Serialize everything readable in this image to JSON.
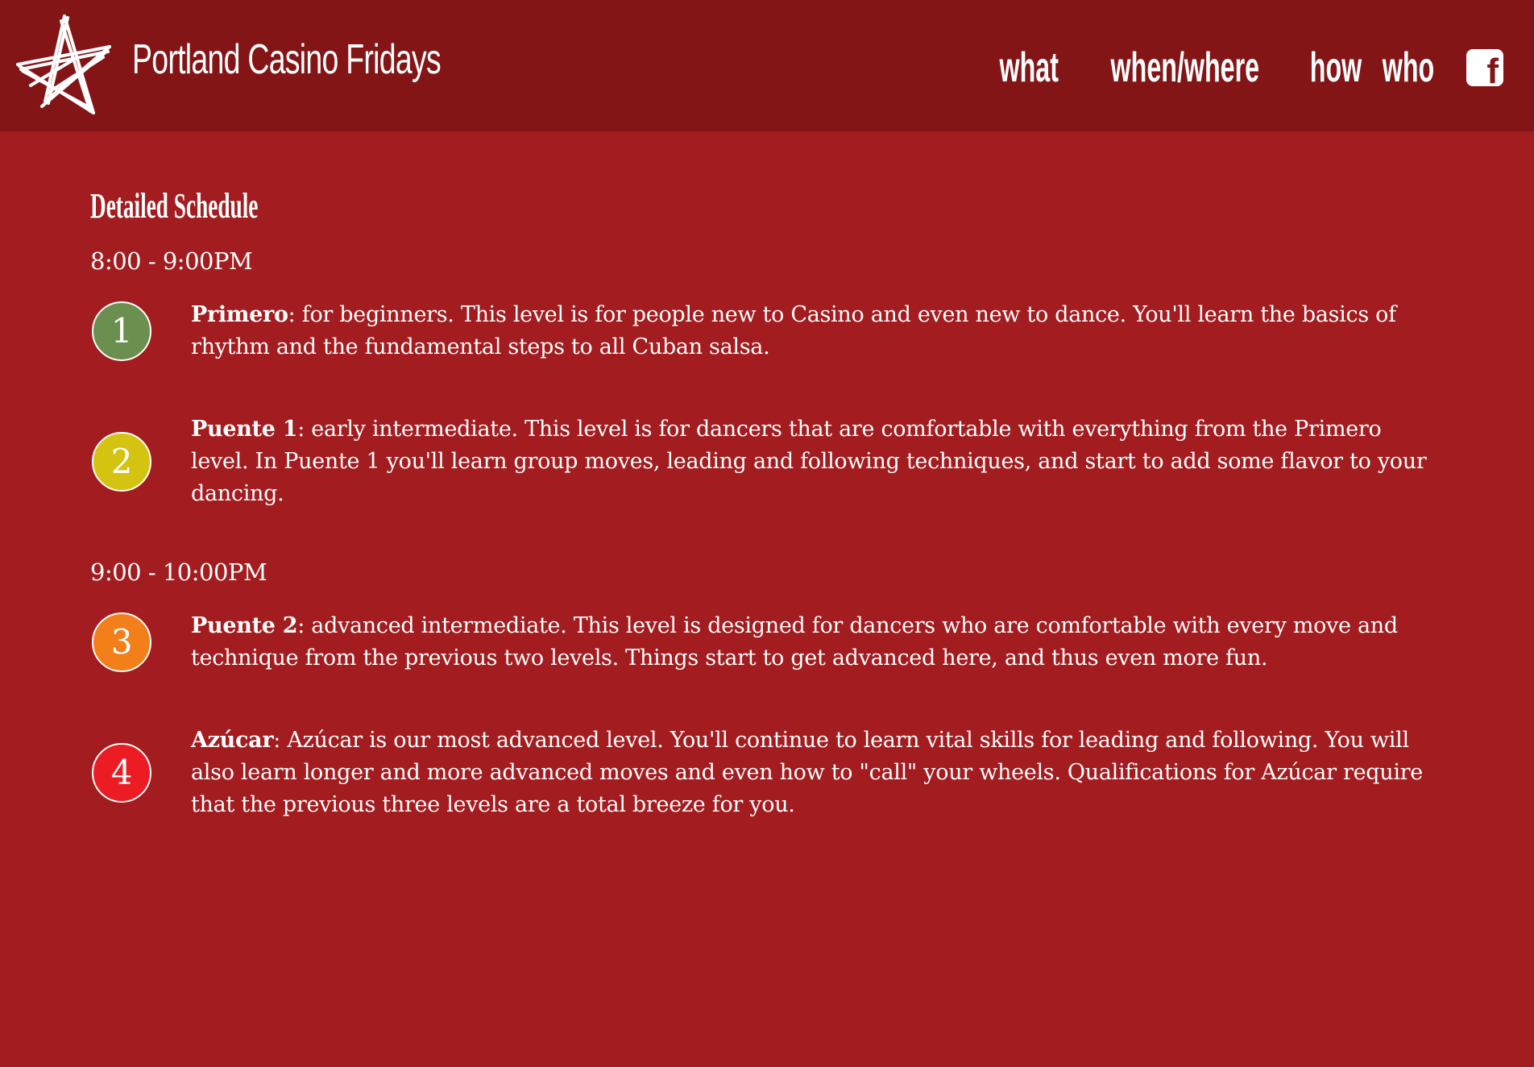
{
  "header": {
    "site_title": "Portland Casino Fridays",
    "nav": [
      "what",
      "when/where",
      "how",
      "who"
    ],
    "facebook_glyph": "f",
    "logo_icon": "star-icon",
    "social_icon": "facebook-icon"
  },
  "schedule": {
    "title": "Detailed Schedule",
    "slot1_time": "8:00 - 9:00PM",
    "slot2_time": "9:00 - 10:00PM",
    "levels": [
      {
        "number": "1",
        "name": "Primero",
        "color": "#6b8f4e",
        "text": ": for beginners. This level is for people new to Casino and even new to dance. You'll learn the basics of rhythm and the fundamental steps to all Cuban salsa."
      },
      {
        "number": "2",
        "name": "Puente 1",
        "color": "#d4c311",
        "text": ": early intermediate. This level is for dancers that are comfortable with everything from the Primero level. In Puente 1 you'll learn group moves, leading and following techniques, and start to add some flavor to your dancing."
      },
      {
        "number": "3",
        "name": "Puente 2",
        "color": "#f37f1b",
        "text": ": advanced intermediate. This level is designed for dancers who are comfortable with every move and technique from the previous two levels. Things start to get advanced here, and thus even more fun."
      },
      {
        "number": "4",
        "name": "Azúcar",
        "color": "#ec1c24",
        "text": ": Azúcar is our most advanced level. You'll continue to learn vital skills for leading and following. You will also learn longer and more advanced moves and even how to \"call\" your wheels. Qualifications for Azúcar require that the previous three levels are a total breeze for you."
      }
    ]
  }
}
